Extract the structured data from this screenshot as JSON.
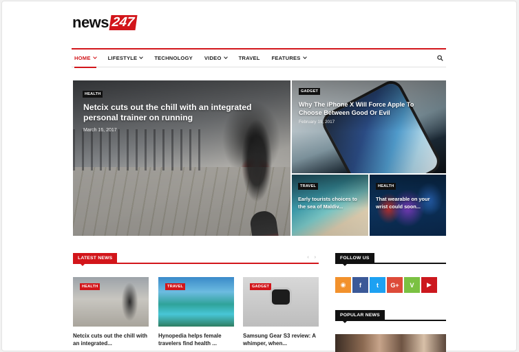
{
  "logo": {
    "word": "news",
    "num": "247"
  },
  "nav": {
    "items": [
      {
        "label": "HOME",
        "dropdown": true
      },
      {
        "label": "LIFESTYLE",
        "dropdown": true
      },
      {
        "label": "TECHNOLOGY",
        "dropdown": false
      },
      {
        "label": "VIDEO",
        "dropdown": true
      },
      {
        "label": "TRAVEL",
        "dropdown": false
      },
      {
        "label": "FEATURES",
        "dropdown": true
      }
    ],
    "search_icon": "search-icon"
  },
  "featured": {
    "main": {
      "badge": "HEALTH",
      "title": "Netcix cuts out the chill with an integrated personal trainer on running",
      "date": "March 16, 2017"
    },
    "top_right": {
      "badge": "GADGET",
      "title": "Why The iPhone X Will Force Apple To Choose Between Good Or Evil",
      "date": "February 19, 2017"
    },
    "bottom_left": {
      "badge": "TRAVEL",
      "title": "Early tourists choices to the sea of Maldiv..."
    },
    "bottom_right": {
      "badge": "HEALTH",
      "title": "That wearable on your wrist could soon..."
    }
  },
  "latest": {
    "header": "LATEST NEWS",
    "pager_prev": "‹",
    "pager_next": "›",
    "cards": [
      {
        "badge": "HEALTH",
        "title": "Netcix cuts out the chill with an integrated..."
      },
      {
        "badge": "TRAVEL",
        "title": "Hynopedia helps female travelers find health ..."
      },
      {
        "badge": "GADGET",
        "title": "Samsung Gear S3 review: A whimper, when..."
      }
    ]
  },
  "follow": {
    "header": "FOLLOW US",
    "icons": [
      {
        "name": "rss-icon",
        "glyph": "◉",
        "color": "#f2912c"
      },
      {
        "name": "facebook-icon",
        "glyph": "f",
        "color": "#3b5998"
      },
      {
        "name": "twitter-icon",
        "glyph": "t",
        "color": "#1da1f2"
      },
      {
        "name": "google-plus-icon",
        "glyph": "G+",
        "color": "#dd4b39"
      },
      {
        "name": "vine-icon",
        "glyph": "V",
        "color": "#7bc142"
      },
      {
        "name": "youtube-icon",
        "glyph": "▶",
        "color": "#cc181e"
      }
    ]
  },
  "popular": {
    "header": "POPULAR NEWS"
  },
  "colors": {
    "accent": "#d2151a",
    "dark": "#111111"
  }
}
